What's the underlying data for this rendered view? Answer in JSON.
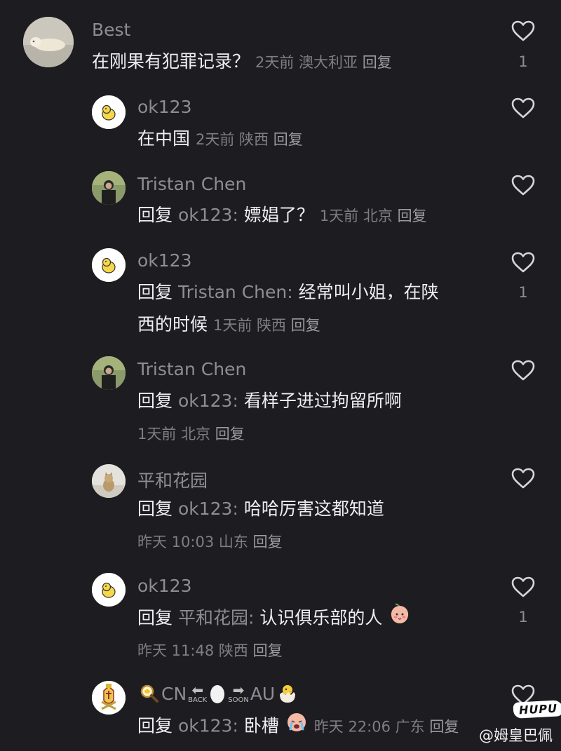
{
  "comments": [
    {
      "user": "Best",
      "text": "在刚果有犯罪记录？",
      "time": "2天前",
      "location": "澳大利亚",
      "reply": "回复",
      "likes": "1"
    },
    {
      "user": "ok123",
      "text": "在中国",
      "time": "2天前",
      "location": "陕西",
      "reply": "回复"
    },
    {
      "user": "Tristan Chen",
      "prefix": "回复",
      "target": "ok123:",
      "text": "嫖娼了？",
      "time": "1天前",
      "location": "北京",
      "reply": "回复"
    },
    {
      "user": "ok123",
      "prefix": "回复",
      "target": "Tristan Chen:",
      "text_line1": "经常叫小姐，在陕",
      "text_line2": "西的时候",
      "time": "1天前",
      "location": "陕西",
      "reply": "回复",
      "likes": "1"
    },
    {
      "user": "Tristan Chen",
      "prefix": "回复",
      "target": "ok123:",
      "text": "看样子进过拘留所啊",
      "time": "1天前",
      "location": "北京",
      "reply": "回复"
    },
    {
      "user": "平和花园",
      "prefix": "回复",
      "target": "ok123:",
      "text": "哈哈厉害这都知道",
      "time": "昨天 10:03",
      "location": "山东",
      "reply": "回复"
    },
    {
      "user": "ok123",
      "prefix": "回复",
      "target": "平和花园:",
      "text": "认识俱乐部的人",
      "time": "昨天 11:48",
      "location": "陕西",
      "reply": "回复",
      "likes": "1"
    },
    {
      "user_cn": "CN",
      "user_back": "BACK",
      "user_soon": "SOON",
      "user_au": "AU",
      "prefix": "回复",
      "target": "ok123:",
      "text": "卧槽",
      "time": "昨天 22:06",
      "location": "广东",
      "reply": "回复"
    }
  ],
  "watermark": "@姆皇巴佩",
  "hupu_logo": "HUPU",
  "icons": {
    "like": "heart-outline-icon",
    "emoji_shy": "peach-emoji-icon",
    "emoji_cry": "crying-emoji-icon"
  },
  "colors": {
    "background": "#1c1c21",
    "primary_text": "#eeeeef",
    "secondary_text": "#8d8d93"
  }
}
